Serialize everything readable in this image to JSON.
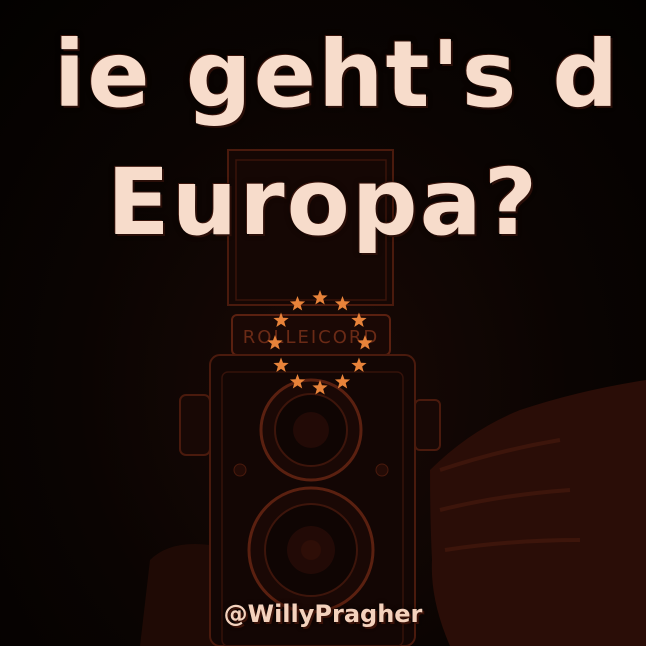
{
  "headline": {
    "line1": "ie geht's d",
    "line2": "Europa?"
  },
  "camera": {
    "brand": "ROLLEICORD"
  },
  "stars": {
    "color": "#e8833a",
    "count": 12
  },
  "handle": "@WillyPragher",
  "colors": {
    "text": "#f7dccb",
    "background": "#050201",
    "tint": "#5a1a0c"
  }
}
